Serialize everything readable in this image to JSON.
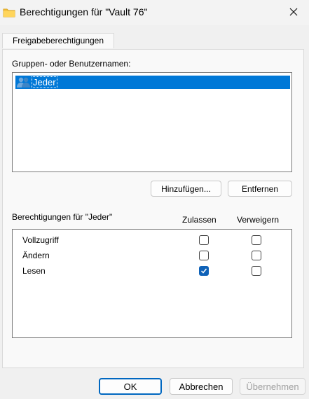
{
  "window": {
    "title": "Berechtigungen für \"Vault 76\"",
    "title_icon": "folder-icon",
    "close_icon": "close-icon"
  },
  "tabs": [
    {
      "label": "Freigabeberechtigungen",
      "selected": true
    }
  ],
  "groups": {
    "label": "Gruppen- oder Benutzernamen:",
    "items": [
      {
        "label": "Jeder",
        "icon": "users-icon",
        "selected": true
      }
    ]
  },
  "buttons": {
    "add_label": "Hinzufügen...",
    "remove_label": "Entfernen"
  },
  "permissions": {
    "label": "Berechtigungen für \"Jeder\"",
    "allow_header": "Zulassen",
    "deny_header": "Verweigern",
    "rows": [
      {
        "name": "Vollzugriff",
        "allow": false,
        "deny": false
      },
      {
        "name": "Ändern",
        "allow": false,
        "deny": false
      },
      {
        "name": "Lesen",
        "allow": true,
        "deny": false
      }
    ]
  },
  "footer": {
    "ok_label": "OK",
    "cancel_label": "Abbrechen",
    "apply_label": "Übernehmen"
  },
  "colors": {
    "selection": "#0078d7",
    "checkbox_checked": "#0f62b8",
    "default_button_border": "#0067c0"
  }
}
